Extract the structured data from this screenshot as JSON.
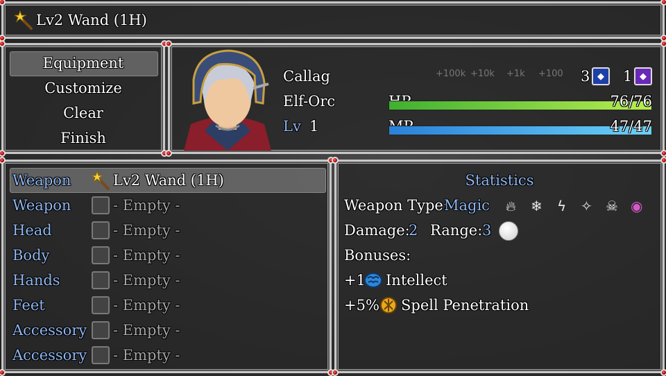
{
  "header": {
    "title": "Lv2 Wand (1H)",
    "icon": "wand-icon"
  },
  "menu": {
    "items": [
      {
        "label": "Equipment",
        "selected": true
      },
      {
        "label": "Customize",
        "selected": false
      },
      {
        "label": "Clear",
        "selected": false
      },
      {
        "label": "Finish",
        "selected": false
      }
    ]
  },
  "actor": {
    "name": "Callag",
    "race": "Elf-Orc",
    "level_label": "Lv",
    "level": "1",
    "hp_label": "HP",
    "hp": "76/76",
    "hp_fraction": 1.0,
    "mp_label": "MP",
    "mp": "47/47",
    "mp_fraction": 1.0,
    "currency_a": "3",
    "currency_b": "1",
    "ghost_costs": [
      "+100k",
      "+10k",
      "+1k",
      "+100"
    ],
    "colors": {
      "hp_bar": "#7ed84a",
      "mp_bar": "#4aa8e8",
      "badge_blue": "#1d3fa8",
      "badge_purple": "#6a28b8"
    }
  },
  "slots": [
    {
      "type": "Weapon",
      "item": "Lv2 Wand (1H)",
      "filled": true
    },
    {
      "type": "Weapon",
      "item": "- Empty -",
      "filled": false
    },
    {
      "type": "Head",
      "item": "- Empty -",
      "filled": false
    },
    {
      "type": "Body",
      "item": "- Empty -",
      "filled": false
    },
    {
      "type": "Hands",
      "item": "- Empty -",
      "filled": false
    },
    {
      "type": "Feet",
      "item": "- Empty -",
      "filled": false
    },
    {
      "type": "Accessory",
      "item": "- Empty -",
      "filled": false
    },
    {
      "type": "Accessory",
      "item": "- Empty -",
      "filled": false
    }
  ],
  "stats": {
    "title": "Statistics",
    "weapon_type_label": "Weapon Type:",
    "weapon_type": "Magic",
    "element_icons": [
      "fire-icon",
      "frost-icon",
      "lightning-icon",
      "holy-icon",
      "death-icon",
      "eye-icon"
    ],
    "damage_label": "Damage:",
    "damage": "2",
    "range_label": "Range:",
    "range": "3",
    "bonuses_label": "Bonuses:",
    "bonuses": [
      {
        "value": "+1",
        "icon": "brain-icon",
        "name": "Intellect"
      },
      {
        "value": "+5%",
        "icon": "spell-penetration-icon",
        "name": "Spell Penetration"
      }
    ]
  }
}
